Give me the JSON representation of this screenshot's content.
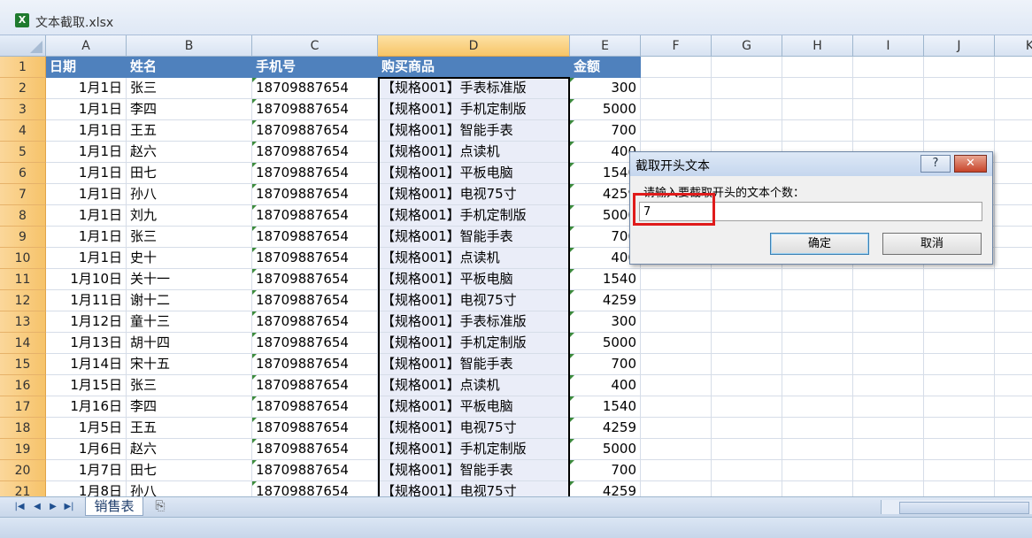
{
  "window": {
    "title": "文本截取.xlsx"
  },
  "columns": [
    "A",
    "B",
    "C",
    "D",
    "E",
    "F",
    "G",
    "H",
    "I",
    "J",
    "K"
  ],
  "header_row": [
    "日期",
    "姓名",
    "手机号",
    "购买商品",
    "金额"
  ],
  "rows": [
    [
      "1月1日",
      "张三",
      "18709887654",
      "【规格001】手表标准版",
      "300"
    ],
    [
      "1月1日",
      "李四",
      "18709887654",
      "【规格001】手机定制版",
      "5000"
    ],
    [
      "1月1日",
      "王五",
      "18709887654",
      "【规格001】智能手表",
      "700"
    ],
    [
      "1月1日",
      "赵六",
      "18709887654",
      "【规格001】点读机",
      "400"
    ],
    [
      "1月1日",
      "田七",
      "18709887654",
      "【规格001】平板电脑",
      "1540"
    ],
    [
      "1月1日",
      "孙八",
      "18709887654",
      "【规格001】电视75寸",
      "4259"
    ],
    [
      "1月1日",
      "刘九",
      "18709887654",
      "【规格001】手机定制版",
      "5000"
    ],
    [
      "1月1日",
      "张三",
      "18709887654",
      "【规格001】智能手表",
      "700"
    ],
    [
      "1月1日",
      "史十",
      "18709887654",
      "【规格001】点读机",
      "400"
    ],
    [
      "1月10日",
      "关十一",
      "18709887654",
      "【规格001】平板电脑",
      "1540"
    ],
    [
      "1月11日",
      "谢十二",
      "18709887654",
      "【规格001】电视75寸",
      "4259"
    ],
    [
      "1月12日",
      "童十三",
      "18709887654",
      "【规格001】手表标准版",
      "300"
    ],
    [
      "1月13日",
      "胡十四",
      "18709887654",
      "【规格001】手机定制版",
      "5000"
    ],
    [
      "1月14日",
      "宋十五",
      "18709887654",
      "【规格001】智能手表",
      "700"
    ],
    [
      "1月15日",
      "张三",
      "18709887654",
      "【规格001】点读机",
      "400"
    ],
    [
      "1月16日",
      "李四",
      "18709887654",
      "【规格001】平板电脑",
      "1540"
    ],
    [
      "1月5日",
      "王五",
      "18709887654",
      "【规格001】电视75寸",
      "4259"
    ],
    [
      "1月6日",
      "赵六",
      "18709887654",
      "【规格001】手机定制版",
      "5000"
    ],
    [
      "1月7日",
      "田七",
      "18709887654",
      "【规格001】智能手表",
      "700"
    ],
    [
      "1月8日",
      "孙八",
      "18709887654",
      "【规格001】电视75寸",
      "4259"
    ]
  ],
  "sheet_tabs": {
    "active": "销售表"
  },
  "dialog": {
    "title": "截取开头文本",
    "help_label": "?",
    "close_label": "✕",
    "prompt": "请输入要截取开头的文本个数：",
    "input_value": "7",
    "ok_label": "确定",
    "cancel_label": "取消"
  },
  "colors": {
    "header_fill": "#4f81bd",
    "highlight": "#e01b1b"
  }
}
